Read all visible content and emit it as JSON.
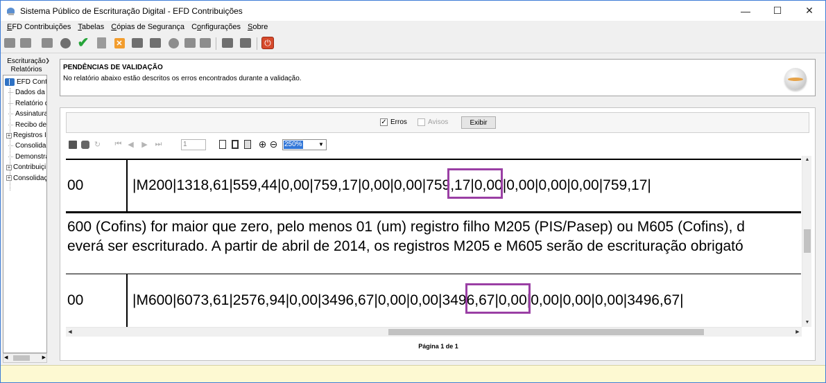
{
  "window": {
    "title": "Sistema Público de Escrituração Digital - EFD Contribuições",
    "controls": {
      "minimize": "—",
      "maximize": "☐",
      "close": "✕"
    }
  },
  "menu": [
    {
      "label": "EFD Contribuições",
      "accel": "E"
    },
    {
      "label": "Tabelas",
      "accel": "T"
    },
    {
      "label": "Cópias de Segurança",
      "accel": "C"
    },
    {
      "label": "Configurações",
      "accel": "o"
    },
    {
      "label": "Sobre",
      "accel": "S"
    }
  ],
  "toolbar": {
    "check_glyph": "✔",
    "x_glyph": "✕",
    "power_glyph": "⏻"
  },
  "left_panel": {
    "tab_escrituracao": "Escrituração",
    "tab_relatorios": "Relatórios",
    "arrow": "❯",
    "tree": [
      {
        "label": "EFD Contri",
        "type": "root"
      },
      {
        "label": "Dados da E",
        "type": "leaf"
      },
      {
        "label": "Relatório d",
        "type": "leaf"
      },
      {
        "label": "Assinatura",
        "type": "leaf"
      },
      {
        "label": "Recibo de",
        "type": "leaf"
      },
      {
        "label": "Registros I",
        "type": "expand"
      },
      {
        "label": "Consolidaç",
        "type": "leaf"
      },
      {
        "label": "Demonstra",
        "type": "leaf"
      },
      {
        "label": "Contribuiçi",
        "type": "expand"
      },
      {
        "label": "Consolidaç",
        "type": "expand"
      }
    ],
    "scroll_left": "◀",
    "scroll_right": "▶"
  },
  "header": {
    "title": "PENDÊNCIAS DE VALIDAÇÃO",
    "description": "No relatório abaixo estão descritos os erros encontrados durante a validação."
  },
  "filters": {
    "erros_label": "Erros",
    "erros_checked": true,
    "avisos_label": "Avisos",
    "avisos_checked": false,
    "check_mark": "✓",
    "exibir_label": "Exibir"
  },
  "report_toolbar": {
    "refresh_glyph": "↻",
    "first_glyph": "⏮",
    "prev_glyph": "◀",
    "next_glyph": "▶",
    "last_glyph": "⏭",
    "page_value": "1",
    "zoom_in_glyph": "⊕",
    "zoom_out_glyph": "⊖",
    "zoom_value": "250%",
    "zoom_arrow": "▼"
  },
  "report": {
    "row1": {
      "code": "00",
      "record_prefix": "|M200|1318,61|559,44|0,00|759,17|0,00|0,00|",
      "record_highlight": "759,17",
      "record_suffix": "|0,00|0,00|0,00|0,00|759,17|"
    },
    "message": {
      "line1": "600 (Cofins) for maior que zero, pelo menos 01 (um) registro filho M205 (PIS/Pasep) ou M605 (Cofins), d",
      "line2": "everá ser escriturado. A partir de abril de 2014, os registros M205 e M605 serão de escrituração obrigató"
    },
    "row2": {
      "code": "00",
      "record_prefix": "|M600|6073,61|2576,94|0,00|3496,67|0,00|0,00|",
      "record_highlight": "3496,67",
      "record_suffix": "|0,00|0,00|0,00|0,00|3496,67|"
    },
    "highlight_color": "#9a3fa4"
  },
  "scrollbars": {
    "up": "▲",
    "down": "▼",
    "left": "◀",
    "right": "▶"
  },
  "footer": {
    "page_label": "Página 1 de 1"
  }
}
